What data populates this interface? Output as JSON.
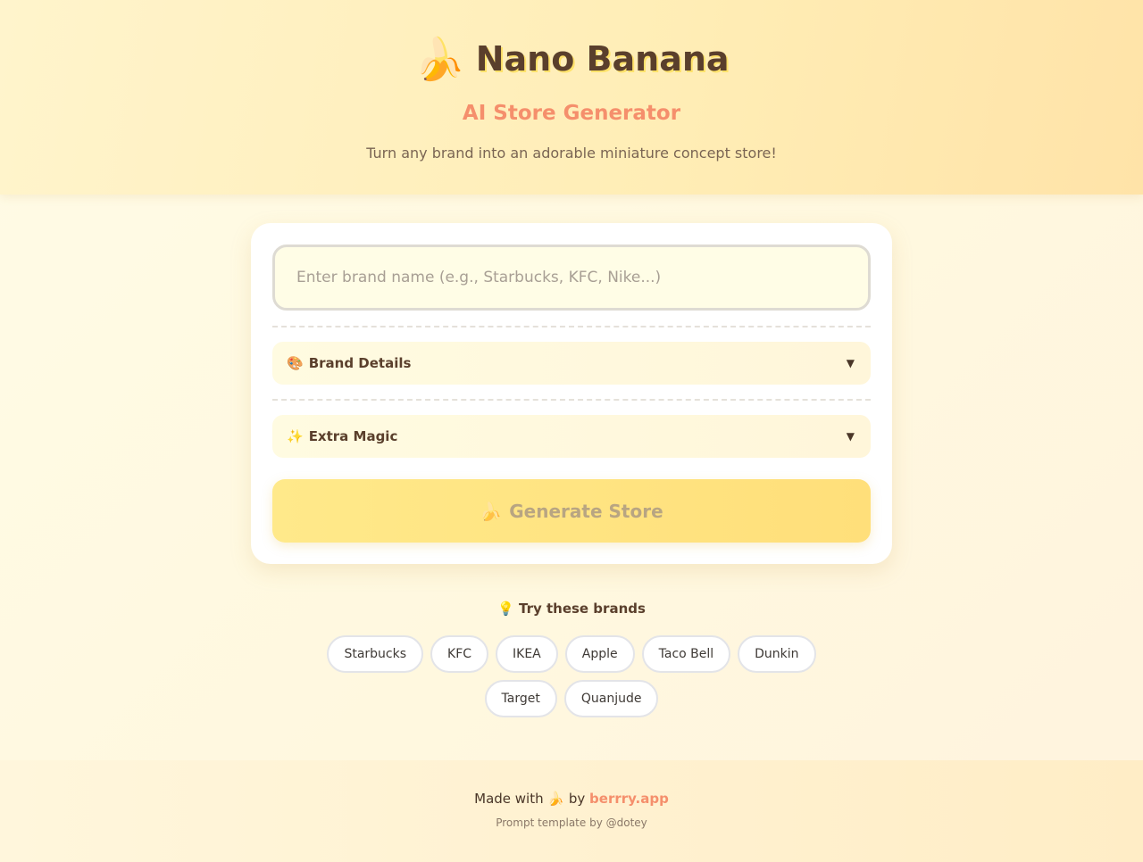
{
  "header": {
    "logo_icon": "🍌",
    "title": "Nano Banana",
    "subtitle": "AI Store Generator",
    "tagline": "Turn any brand into an adorable miniature concept store!"
  },
  "form": {
    "brand_input": {
      "placeholder": "Enter brand name (e.g., Starbucks, KFC, Nike...)",
      "value": ""
    },
    "sections": [
      {
        "icon": "🎨",
        "label": "Brand Details",
        "caret": "▼"
      },
      {
        "icon": "✨",
        "label": "Extra Magic",
        "caret": "▼"
      }
    ],
    "generate_button": {
      "icon": "🍌",
      "label": "Generate Store"
    }
  },
  "suggestions": {
    "icon": "💡",
    "title": "Try these brands",
    "brands": [
      "Starbucks",
      "KFC",
      "IKEA",
      "Apple",
      "Taco Bell",
      "Dunkin",
      "Target",
      "Quanjude"
    ]
  },
  "footer": {
    "made_with_prefix": "Made with",
    "made_with_icon": "🍌",
    "by_text": "by",
    "link_text": "berrry.app",
    "credit": "Prompt template by @dotey"
  },
  "colors": {
    "accent": "#f58f6c",
    "title": "#5a3f2c",
    "button": "#ffe58a"
  }
}
